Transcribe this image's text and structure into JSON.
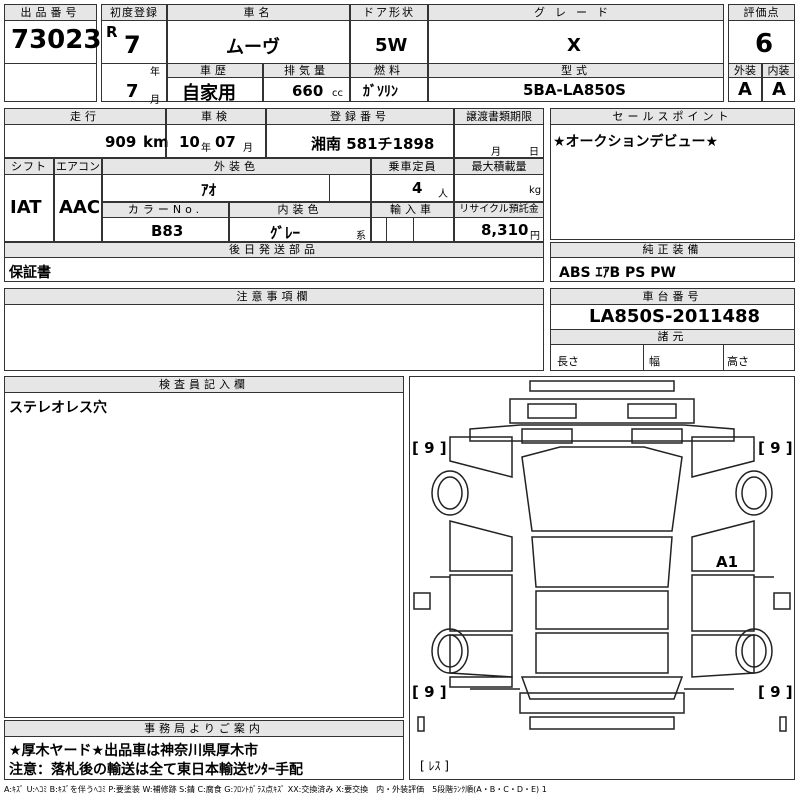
{
  "lot": {
    "label": "出品番号",
    "value": "73023"
  },
  "first_reg": {
    "label": "初度登録",
    "era": "R",
    "year": "7",
    "year_unit": "年",
    "month": "7",
    "month_unit": "月"
  },
  "car_name": {
    "label": "車名",
    "value": "ムーヴ"
  },
  "door": {
    "label": "ドア形状",
    "value": "5W"
  },
  "grade": {
    "label": "グレード",
    "value": "X"
  },
  "score": {
    "label": "評価点",
    "value": "6"
  },
  "history": {
    "label": "車歴",
    "value": "自家用"
  },
  "displacement": {
    "label": "排気量",
    "value": "660",
    "unit": "cc"
  },
  "fuel": {
    "label": "燃料",
    "value": "ｶﾞｿﾘﾝ"
  },
  "model": {
    "label": "型式",
    "value": "5BA-LA850S"
  },
  "exterior": {
    "label": "外装",
    "value": "A"
  },
  "interior": {
    "label": "内装",
    "value": "A"
  },
  "mileage": {
    "label": "走行",
    "value": "909",
    "unit": "km"
  },
  "inspection": {
    "label": "車検",
    "year": "10",
    "year_unit": "年",
    "month": "07",
    "month_unit": "月"
  },
  "plate": {
    "label": "登録番号",
    "value": "湘南 581チ1898"
  },
  "transfer": {
    "label": "譲渡書類期限",
    "month_unit": "月",
    "day_unit": "日"
  },
  "sales_point": {
    "label": "セールスポイント",
    "value": "★オークションデビュー★"
  },
  "shift": {
    "label": "シフト",
    "value": "IAT"
  },
  "aircon": {
    "label": "エアコン",
    "value": "AAC"
  },
  "ext_color": {
    "label": "外装色",
    "value": "ｱｵ"
  },
  "seats": {
    "label": "乗車定員",
    "value": "4",
    "unit": "人"
  },
  "load": {
    "label": "最大積載量",
    "unit": "kg"
  },
  "color_no": {
    "label": "カラーNo.",
    "value": "B83"
  },
  "int_color": {
    "label": "内装色",
    "value": "ｸﾞﾚｰ",
    "unit": "系"
  },
  "import": {
    "label": "輸入車"
  },
  "recycle": {
    "label": "リサイクル預託金",
    "value": "8,310",
    "unit": "円"
  },
  "later_parts": {
    "label": "後日発送部品",
    "value": "保証書"
  },
  "equipment": {
    "label": "純正装備",
    "value": "ABS ｴｱB PS PW"
  },
  "notes": {
    "label": "注意事項欄"
  },
  "chassis": {
    "label": "車台番号",
    "value": "LA850S-2011488"
  },
  "specs": {
    "label": "諸元",
    "length": "長さ",
    "width": "幅",
    "height": "高さ"
  },
  "inspector": {
    "label": "検査員記入欄",
    "value": "ステレオレス穴"
  },
  "office": {
    "label": "事務局よりご案内",
    "line1": "★厚木ヤード★出品車は神奈川県厚木市",
    "line2": "注意：落札後の輸送は全て東日本輸送ｾﾝﾀｰ手配"
  },
  "diagram": {
    "tire_fl": "[ 9 ]",
    "tire_fr": "[ 9 ]",
    "tire_rl": "[ 9 ]",
    "tire_rr": "[ 9 ]",
    "mark": "A1",
    "spare": "[ ﾚｽ ]"
  },
  "legend": "A:ｷｽﾞ U:ﾍｺﾐ B:ｷｽﾞを伴うﾍｺﾐ P:要塗装 W:補修跡 S:錆 C:腐食 G:ﾌﾛﾝﾄｶﾞﾗｽ点ｷｽﾞ XX:交換済み X:要交換　内・外装評価　5段階ﾗﾝｸ順(A・B・C・D・E) 1"
}
